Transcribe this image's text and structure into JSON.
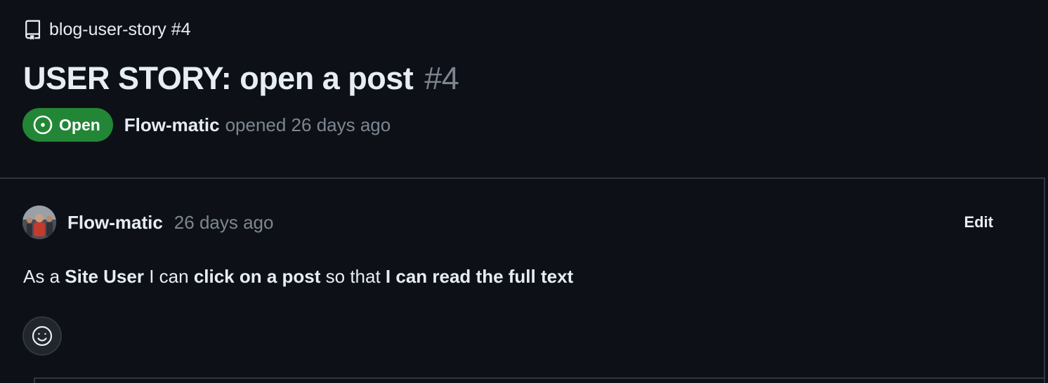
{
  "repo": {
    "name": "blog-user-story",
    "issue_ref": "#4",
    "icon": "repo-icon"
  },
  "issue": {
    "title": "USER STORY: open a post",
    "number": "#4",
    "state_label": "Open",
    "state_icon": "issue-opened-icon",
    "state_color": "#238636",
    "author": "Flow-matic",
    "opened_text": "opened 26 days ago"
  },
  "comment": {
    "author": "Flow-matic",
    "time": "26 days ago",
    "edit_label": "Edit",
    "avatar_icon": "avatar",
    "body": {
      "part1": "As a ",
      "strong1": "Site User",
      "part2": " I can ",
      "strong2": "click on a post",
      "part3": " so that ",
      "strong3": "I can read the full text"
    },
    "reaction_icon": "smiley-icon"
  },
  "colors": {
    "background": "#0d1117",
    "text": "#e6edf3",
    "muted": "#7d8590",
    "border": "#30363d",
    "open_badge": "#238636"
  }
}
